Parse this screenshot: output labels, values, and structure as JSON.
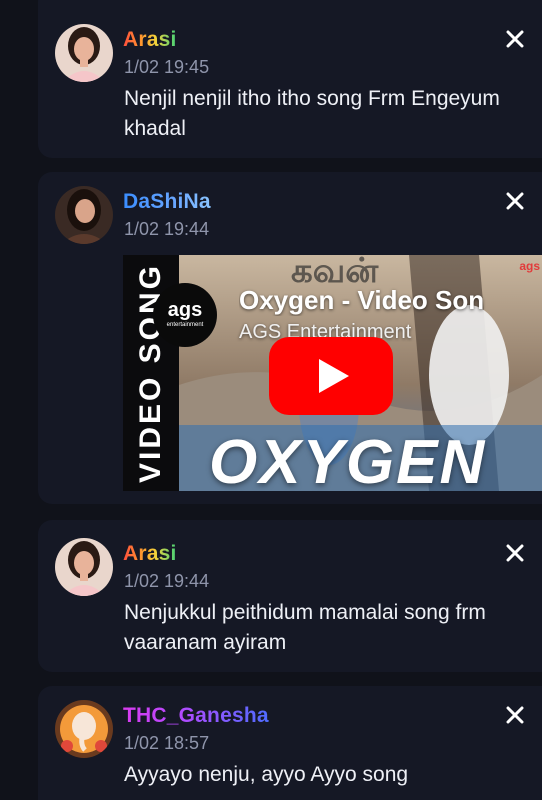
{
  "posts": [
    {
      "username": "Arasi",
      "time": "1/02 19:45",
      "message": "Nenjil nenjil itho itho song Frm Engeyum khadal"
    },
    {
      "username": "DaShiNa",
      "time": "1/02 19:44",
      "video": {
        "title": "Oxygen - Video Son",
        "channel": "AGS Entertainment",
        "side_text": "VIDEO SONG",
        "overlay_text": "OXYGEN",
        "channel_logo_text": "ags",
        "channel_logo_subtext": "entertainment",
        "corner_logo_text": "ags",
        "tamil_title": "கவன்"
      }
    },
    {
      "username": "Arasi",
      "time": "1/02 19:44",
      "message": "Nenjukkul peithidum mamalai song frm vaaranam ayiram"
    },
    {
      "username": "THC_Ganesha",
      "time": "1/02 18:57",
      "message": "Ayyayo nenju, ayyo Ayyo song"
    }
  ],
  "icons": {
    "close": "close-icon",
    "play": "play-icon"
  },
  "colors": {
    "background": "#10121a",
    "card": "#151825",
    "timestamp": "#8f95ab",
    "message_text": "#eef0f6",
    "youtube_red": "#ff0000"
  }
}
